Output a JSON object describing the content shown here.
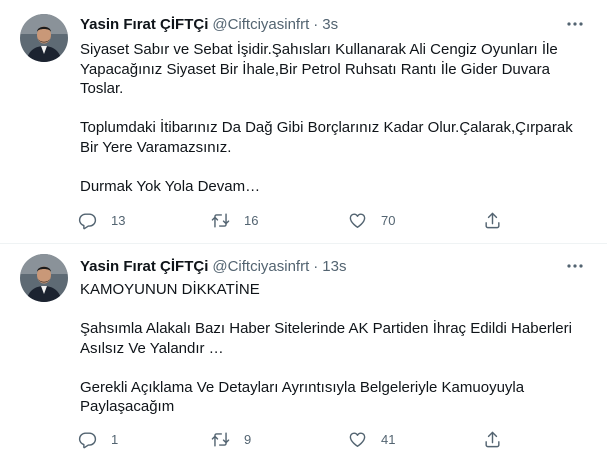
{
  "tweets": [
    {
      "name": "Yasin Fırat ÇİFTÇi",
      "handle": "@Ciftciyasinfrt",
      "separator": "·",
      "time": "3s",
      "text_lines": [
        "Siyaset Sabır ve Sebat İşidir.Şahısları Kullanarak Ali Cengiz Oyunları İle",
        "Yapacağınız Siyaset Bir İhale,Bir Petrol Ruhsatı Rantı İle Gider Duvara",
        "Toslar.",
        "",
        "Toplumdaki İtibarınız Da Dağ Gibi Borçlarınız Kadar Olur.Çalarak,Çırparak",
        "Bir Yere Varamazsınız.",
        "",
        "Durmak Yok Yola Devam…"
      ],
      "replies": "13",
      "retweets": "16",
      "likes": "70"
    },
    {
      "name": "Yasin Fırat ÇİFTÇi",
      "handle": "@Ciftciyasinfrt",
      "separator": "·",
      "time": "13s",
      "text_lines": [
        "KAMOYUNUN DİKKATİNE",
        "",
        "Şahsımla Alakalı Bazı Haber Sitelerinde AK Partiden İhraç Edildi Haberleri",
        "Asılsız Ve Yalandır …",
        "",
        "Gerekli Açıklama Ve Detayları Ayrıntısıyla  Belgeleriyle Kamuoyuyla",
        "Paylaşacağım"
      ],
      "replies": "1",
      "retweets": "9",
      "likes": "41"
    }
  ],
  "icons": {
    "reply": "reply-icon",
    "retweet": "retweet-icon",
    "like": "heart-icon",
    "share": "share-icon",
    "more": "more-icon"
  },
  "colors": {
    "text": "#0f1419",
    "muted": "#536471",
    "divider": "#eff3f4"
  }
}
